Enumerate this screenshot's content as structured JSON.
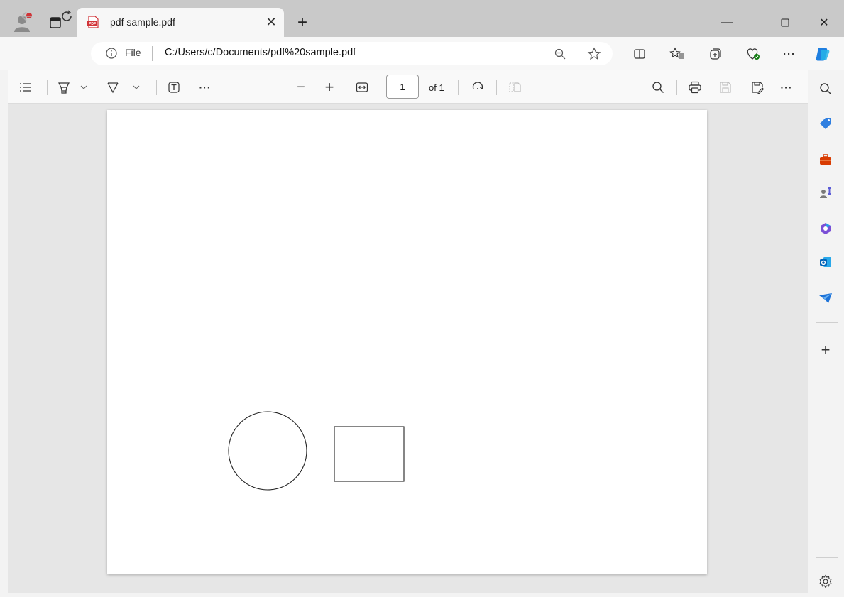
{
  "tab": {
    "title": "pdf sample.pdf",
    "close_glyph": "✕",
    "new_tab_glyph": "+"
  },
  "window_controls": {
    "minimize": "—",
    "maximize": "☐",
    "close": "✕"
  },
  "address": {
    "scheme_label": "File",
    "url": "C:/Users/c/Documents/pdf%20sample.pdf"
  },
  "pdf_toolbar": {
    "zoom_out": "−",
    "zoom_in": "+",
    "more": "···",
    "page_current": "1",
    "page_of": "of 1",
    "more_right": "···"
  },
  "navbar": {
    "more": "···"
  },
  "sidebar": {
    "add": "+"
  },
  "document": {
    "shapes": [
      {
        "kind": "circle"
      },
      {
        "kind": "rectangle"
      }
    ]
  },
  "colors": {
    "titlebar": "#c9c9c9",
    "viewer_bg": "#e6e6e6",
    "page": "#ffffff",
    "shape_stroke": "#222222",
    "accent_red": "#d13438"
  },
  "icons": [
    "profile-icon",
    "tab-actions-icon",
    "pdf-file-icon",
    "back-icon",
    "refresh-icon",
    "info-icon",
    "zoom-icon",
    "favorite-star-icon",
    "split-screen-icon",
    "favorites-icon",
    "collections-icon",
    "browser-essentials-icon",
    "copilot-icon",
    "contents-icon",
    "highlight-icon",
    "draw-icon",
    "text-icon",
    "fit-page-icon",
    "rotate-icon",
    "page-view-icon",
    "search-icon",
    "print-icon",
    "save-icon",
    "save-as-icon",
    "shopping-tag-icon",
    "tools-icon",
    "games-icon",
    "microsoft-365-icon",
    "outlook-icon",
    "telegram-icon",
    "settings-icon"
  ]
}
